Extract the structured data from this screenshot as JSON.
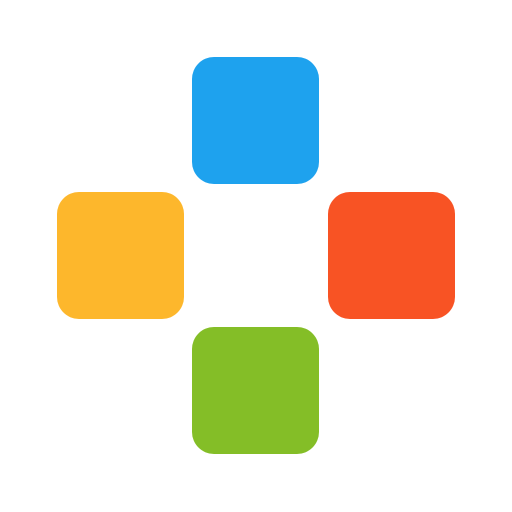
{
  "icon": {
    "name": "four-square-cross-icon",
    "tiles": [
      {
        "id": "top",
        "color": "#1EA2EE"
      },
      {
        "id": "left",
        "color": "#FDB72C"
      },
      {
        "id": "right",
        "color": "#F85324"
      },
      {
        "id": "bottom",
        "color": "#84BE27"
      }
    ]
  },
  "colors": {
    "background": "#FFFFFF"
  }
}
